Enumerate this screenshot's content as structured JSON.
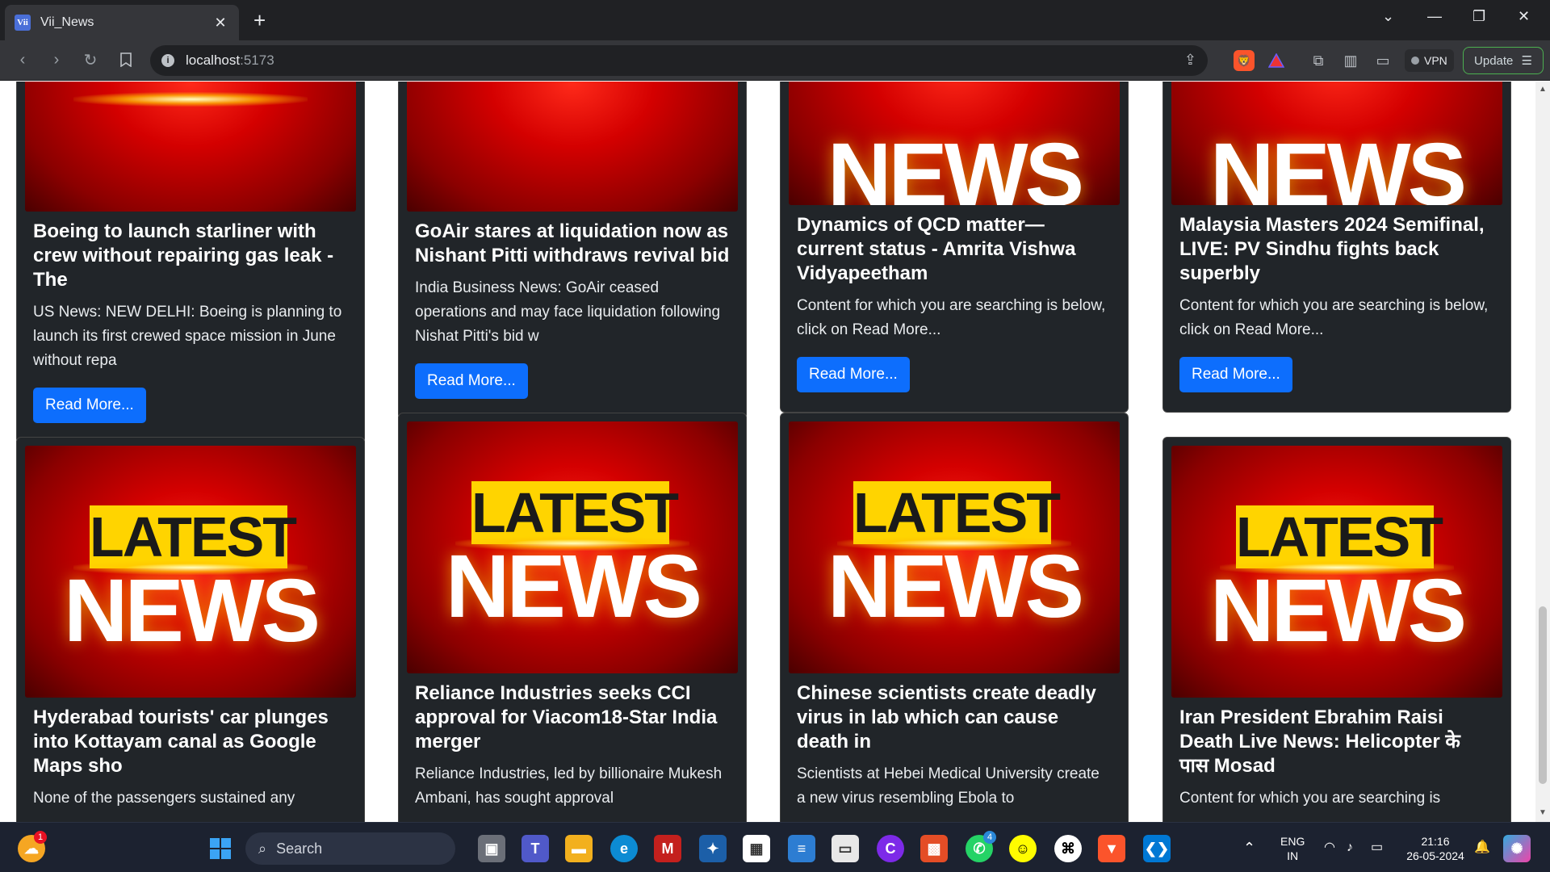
{
  "browser": {
    "tab_title": "Vii_News",
    "favicon_text": "Vii",
    "url_host": "localhost",
    "url_port": ":5173",
    "vpn_label": "VPN",
    "update_label": "Update"
  },
  "cards": [
    {
      "title": "Boeing to launch starliner with crew without repairing gas leak - The",
      "description": "US News: NEW DELHI: Boeing is planning to launch its first crewed space mission in June without repa",
      "button": "Read More..."
    },
    {
      "title": "GoAir stares at liquidation now as Nishant Pitti withdraws revival bid",
      "description": "India Business News: GoAir ceased operations and may face liquidation following Nishat Pitti's bid w",
      "button": "Read More..."
    },
    {
      "title": "Dynamics of QCD matter— current status - Amrita Vishwa Vidyapeetham",
      "description": "Content for which you are searching is below, click on Read More...",
      "button": "Read More..."
    },
    {
      "title": "Malaysia Masters 2024 Semifinal, LIVE: PV Sindhu fights back superbly",
      "description": "Content for which you are searching is below, click on Read More...",
      "button": "Read More..."
    },
    {
      "image_top": "LATEST",
      "image_bottom": "NEWS",
      "title": "Hyderabad tourists' car plunges into Kottayam canal as Google Maps sho",
      "description": "None of the passengers sustained any"
    },
    {
      "image_top": "LATEST",
      "image_bottom": "NEWS",
      "title": "Reliance Industries seeks CCI approval for Viacom18-Star India merger",
      "description": "Reliance Industries, led by billionaire Mukesh Ambani, has sought approval"
    },
    {
      "image_top": "LATEST",
      "image_bottom": "NEWS",
      "title": "Chinese scientists create deadly virus in lab which can cause death in",
      "description": "Scientists at Hebei Medical University create a new virus resembling Ebola to"
    },
    {
      "image_top": "LATEST",
      "image_bottom": "NEWS",
      "title": "Iran President Ebrahim Raisi Death Live News: Helicopter के पास Mosad",
      "description": "Content for which you are searching is"
    }
  ],
  "taskbar": {
    "search_label": "Search",
    "weather_badge": "1",
    "whatsapp_badge": "4",
    "lang_line1": "ENG",
    "lang_line2": "IN",
    "time": "21:16",
    "date": "26-05-2024"
  },
  "colors": {
    "card_bg": "#212529",
    "button_blue": "#0d6efd",
    "news_red": "#d40000",
    "latest_yellow": "#ffd400"
  }
}
